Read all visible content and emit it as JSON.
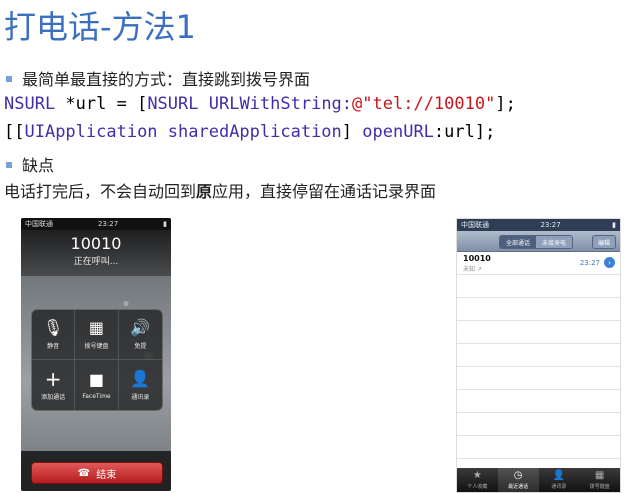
{
  "slide": {
    "title": "打电话-方法1",
    "bullet1": "最简单最直接的方式：直接跳到拨号界面",
    "code1": {
      "cls": "NSURL",
      "var": " *url = [",
      "cls2": "NSURL",
      "method": " URLWithString:",
      "at": "@",
      "str": "\"tel://10010\"",
      "end": "];"
    },
    "code2": {
      "open": "[[",
      "cls": "UIApplication",
      "m1": " sharedApplication",
      "mid": "] ",
      "m2": "openURL",
      "end": ":url];"
    },
    "bullet2": "缺点",
    "line_before": "电话打完后，不会自动回到",
    "line_bold": "原",
    "line_after": "应用，直接停留在通话记录界面"
  },
  "phone_call": {
    "status_carrier": "中国联通",
    "status_time": "23:27",
    "number": "10010",
    "calling": "正在呼叫...",
    "keys": [
      {
        "icon": "mic-mute-icon",
        "glyph": "🎙",
        "label": "静音"
      },
      {
        "icon": "keypad-icon",
        "glyph": "▦",
        "label": "拨号键盘"
      },
      {
        "icon": "speaker-icon",
        "glyph": "🔊",
        "label": "免提"
      },
      {
        "icon": "add-call-icon",
        "glyph": "+",
        "label": "添加通话"
      },
      {
        "icon": "facetime-icon",
        "glyph": "■",
        "label": "FaceTime"
      },
      {
        "icon": "contacts-icon",
        "glyph": "👤",
        "label": "通讯录"
      }
    ],
    "end_label": "结束"
  },
  "phone_recents": {
    "status_carrier": "中国联通",
    "status_time": "23:27",
    "seg_all": "全部通话",
    "seg_missed": "未接来电",
    "edit": "编辑",
    "entry_number": "10010",
    "entry_sub": "未知",
    "entry_time": "23:27",
    "tabs": [
      {
        "icon": "star-icon",
        "glyph": "★",
        "label": "个人收藏"
      },
      {
        "icon": "clock-icon",
        "glyph": "◷",
        "label": "最近通话"
      },
      {
        "icon": "person-icon",
        "glyph": "👤",
        "label": "通讯录"
      },
      {
        "icon": "keypad-icon",
        "glyph": "▦",
        "label": "拨号键盘"
      }
    ]
  }
}
